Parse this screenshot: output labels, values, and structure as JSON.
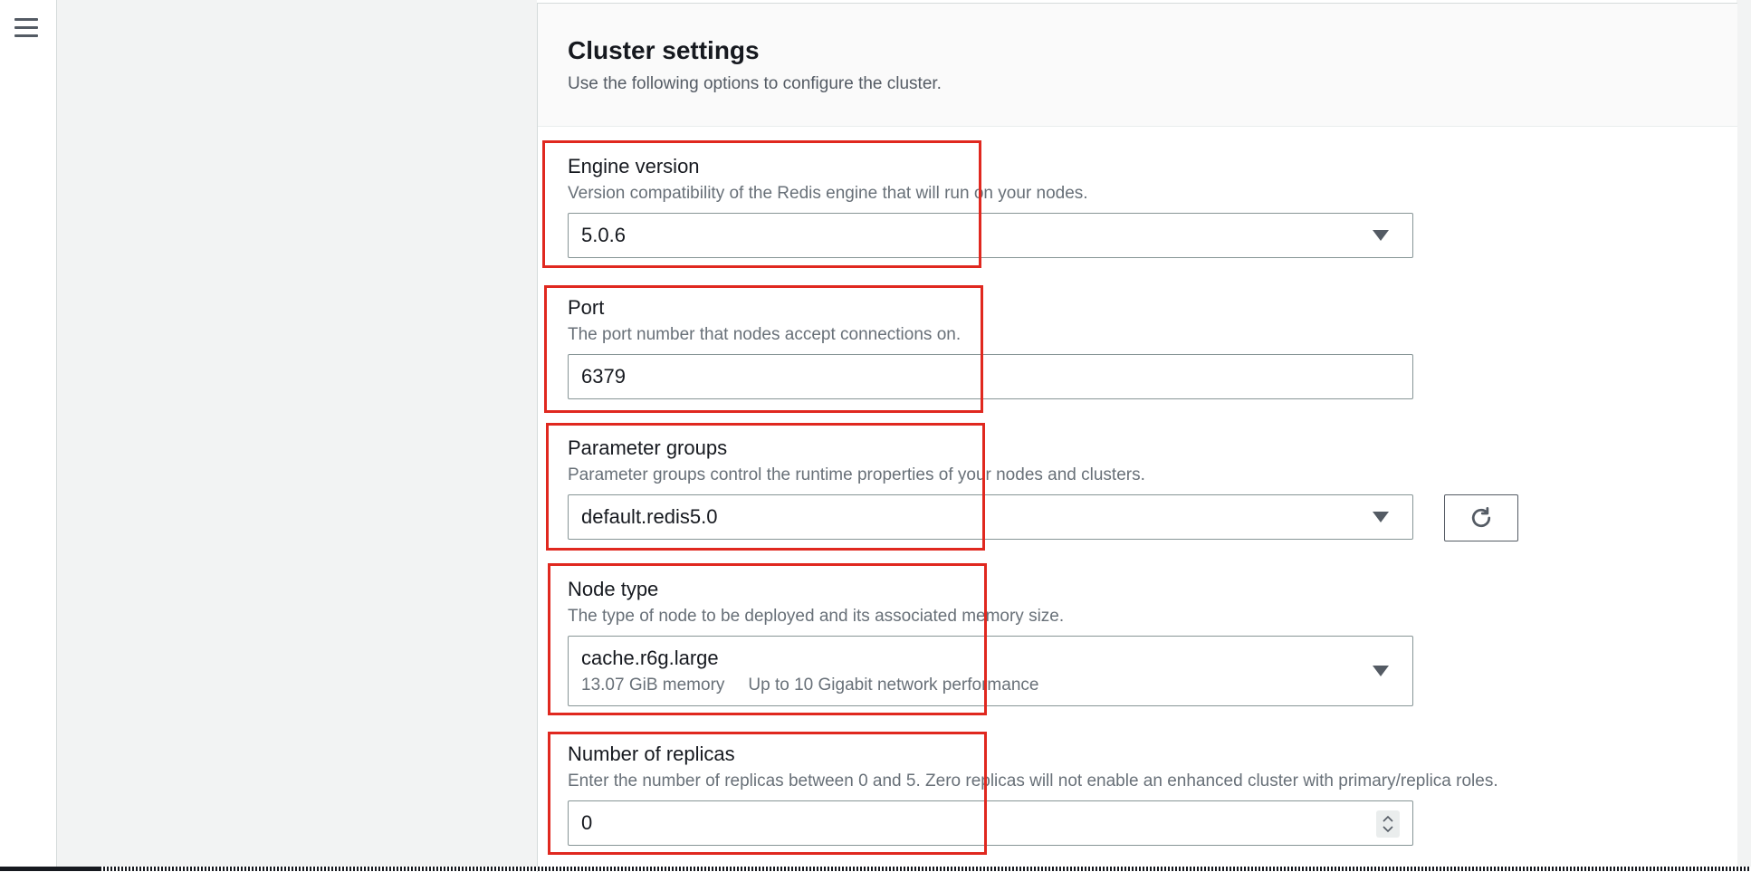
{
  "section": {
    "title": "Cluster settings",
    "description": "Use the following options to configure the cluster."
  },
  "engine_version": {
    "label": "Engine version",
    "description": "Version compatibility of the Redis engine that will run on your nodes.",
    "value": "5.0.6"
  },
  "port": {
    "label": "Port",
    "description": "The port number that nodes accept connections on.",
    "value": "6379"
  },
  "parameter_groups": {
    "label": "Parameter groups",
    "description": "Parameter groups control the runtime properties of your nodes and clusters.",
    "value": "default.redis5.0"
  },
  "node_type": {
    "label": "Node type",
    "description": "The type of node to be deployed and its associated memory size.",
    "value": "cache.r6g.large",
    "memory": "13.07 GiB memory",
    "network": "Up to 10 Gigabit network performance"
  },
  "replicas": {
    "label": "Number of replicas",
    "description": "Enter the number of replicas between 0 and 5. Zero replicas will not enable an enhanced cluster with primary/replica roles.",
    "value": "0"
  },
  "colors": {
    "highlight": "#e0281f",
    "border": "#879596",
    "background": "#f2f3f3"
  },
  "icons": [
    "menu-icon",
    "caret-down-icon",
    "refresh-icon",
    "stepper-icon"
  ]
}
